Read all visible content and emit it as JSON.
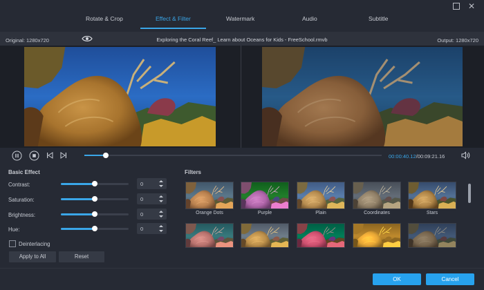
{
  "tabs": [
    "Rotate & Crop",
    "Effect & Filter",
    "Watermark",
    "Audio",
    "Subtitle"
  ],
  "info": {
    "original": "Original: 1280x720",
    "file_title": "Exploring the Coral Reef_ Learn about Oceans for Kids - FreeSchool.rmvb",
    "output": "Output: 1280x720"
  },
  "player": {
    "current_time": "00:00:40.12",
    "total_time": "/00:09:21.16",
    "progress_fraction": 0.072
  },
  "basic_effect": {
    "title": "Basic Effect",
    "rows": [
      {
        "label": "Contrast:",
        "value": "0",
        "level": 0.5
      },
      {
        "label": "Saturation:",
        "value": "0",
        "level": 0.5
      },
      {
        "label": "Brightness:",
        "value": "0",
        "level": 0.5
      },
      {
        "label": "Hue:",
        "value": "0",
        "level": 0.5
      }
    ],
    "deinterlacing": "Deinterlacing",
    "apply_all": "Apply to All",
    "reset": "Reset"
  },
  "filters": {
    "title": "Filters",
    "row1": [
      "Orange Dots",
      "Purple",
      "Plain",
      "Coordinates",
      "Stars"
    ]
  },
  "buttons": {
    "ok": "OK",
    "cancel": "Cancel"
  },
  "colors": {
    "accent": "#3aa6e8",
    "primary_button": "#27a2ee",
    "background": "#262a34"
  }
}
